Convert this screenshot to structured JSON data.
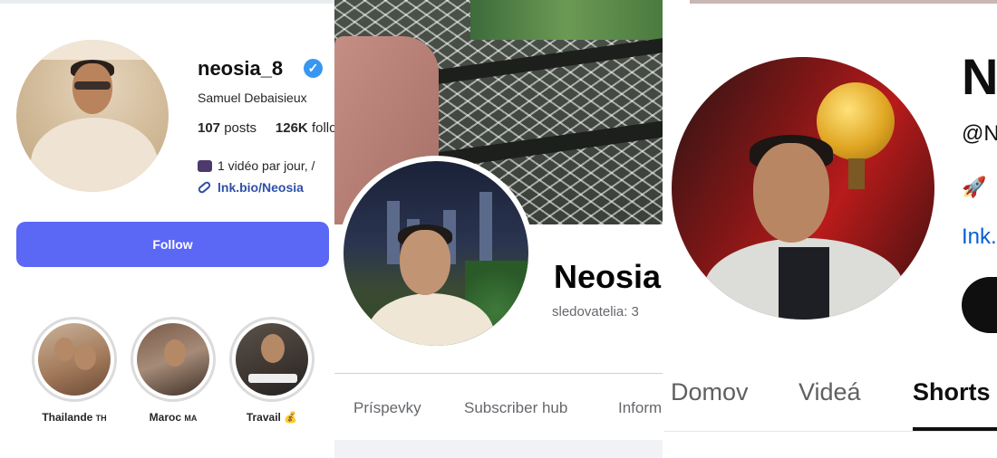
{
  "instagram": {
    "username": "neosia_8",
    "verified_icon": "verified-badge-icon",
    "full_name": "Samuel Debaisieux",
    "posts_count": "107",
    "posts_label": "posts",
    "followers_count": "126K",
    "followers_label": "follo",
    "bio": "1 vidéo par jour, /",
    "link": "lnk.bio/Neosia",
    "follow_label": "Follow",
    "accent_color": "#5b67f5",
    "highlights": [
      {
        "label": "Thailande",
        "suffix": "TH"
      },
      {
        "label": "Maroc",
        "suffix": "MA"
      },
      {
        "label": "Travail",
        "suffix": "💰"
      }
    ]
  },
  "facebook": {
    "name": "Neosia",
    "followers": "sledovatelia: 3",
    "tabs": [
      "Príspevky",
      "Subscriber hub",
      "Inform"
    ]
  },
  "youtube": {
    "name": "N",
    "handle": "@N",
    "rocket_icon": "rocket-icon",
    "link": "Ink.",
    "tabs": [
      "Domov",
      "Videá",
      "Shorts"
    ],
    "active_tab": "Shorts",
    "link_color": "#065fd4"
  }
}
